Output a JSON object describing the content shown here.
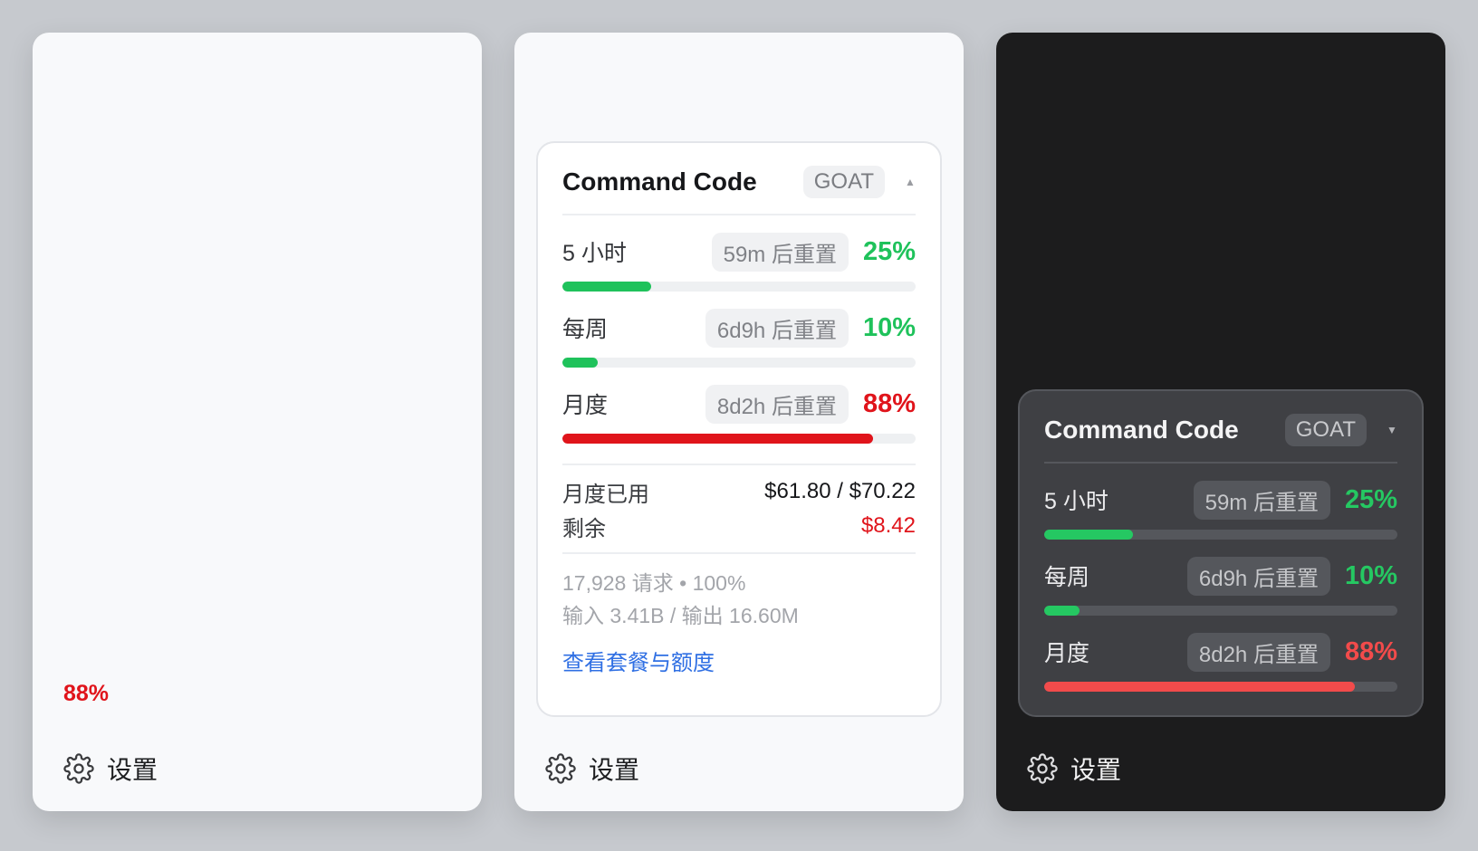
{
  "mini_panel": {
    "percent": "88%"
  },
  "settings": {
    "label": "设置",
    "icon": "gear-icon"
  },
  "card": {
    "title": "Command Code",
    "tier": "GOAT",
    "expanded_caret": "▲",
    "collapsed_caret": "▼",
    "meters": [
      {
        "label": "5 小时",
        "reset": "59m 后重置",
        "percent_text": "25%",
        "fraction": 0.25,
        "status": "ok"
      },
      {
        "label": "每周",
        "reset": "6d9h 后重置",
        "percent_text": "10%",
        "fraction": 0.1,
        "status": "ok"
      },
      {
        "label": "月度",
        "reset": "8d2h 后重置",
        "percent_text": "88%",
        "fraction": 0.88,
        "status": "high"
      }
    ],
    "spend": {
      "used_label": "月度已用",
      "used_value": "$61.80 / $70.22",
      "remaining_label": "剩余",
      "remaining_value": "$8.42"
    },
    "stats": {
      "requests_line": "17,928 请求 • 100%",
      "tokens_line": "输入 3.41B / 输出 16.60M"
    },
    "link": "查看套餐与额度"
  },
  "colors": {
    "ok_light": "#1fc25b",
    "high_light": "#e0141b",
    "ok_dark": "#25c862",
    "high_dark": "#f24b4b"
  }
}
